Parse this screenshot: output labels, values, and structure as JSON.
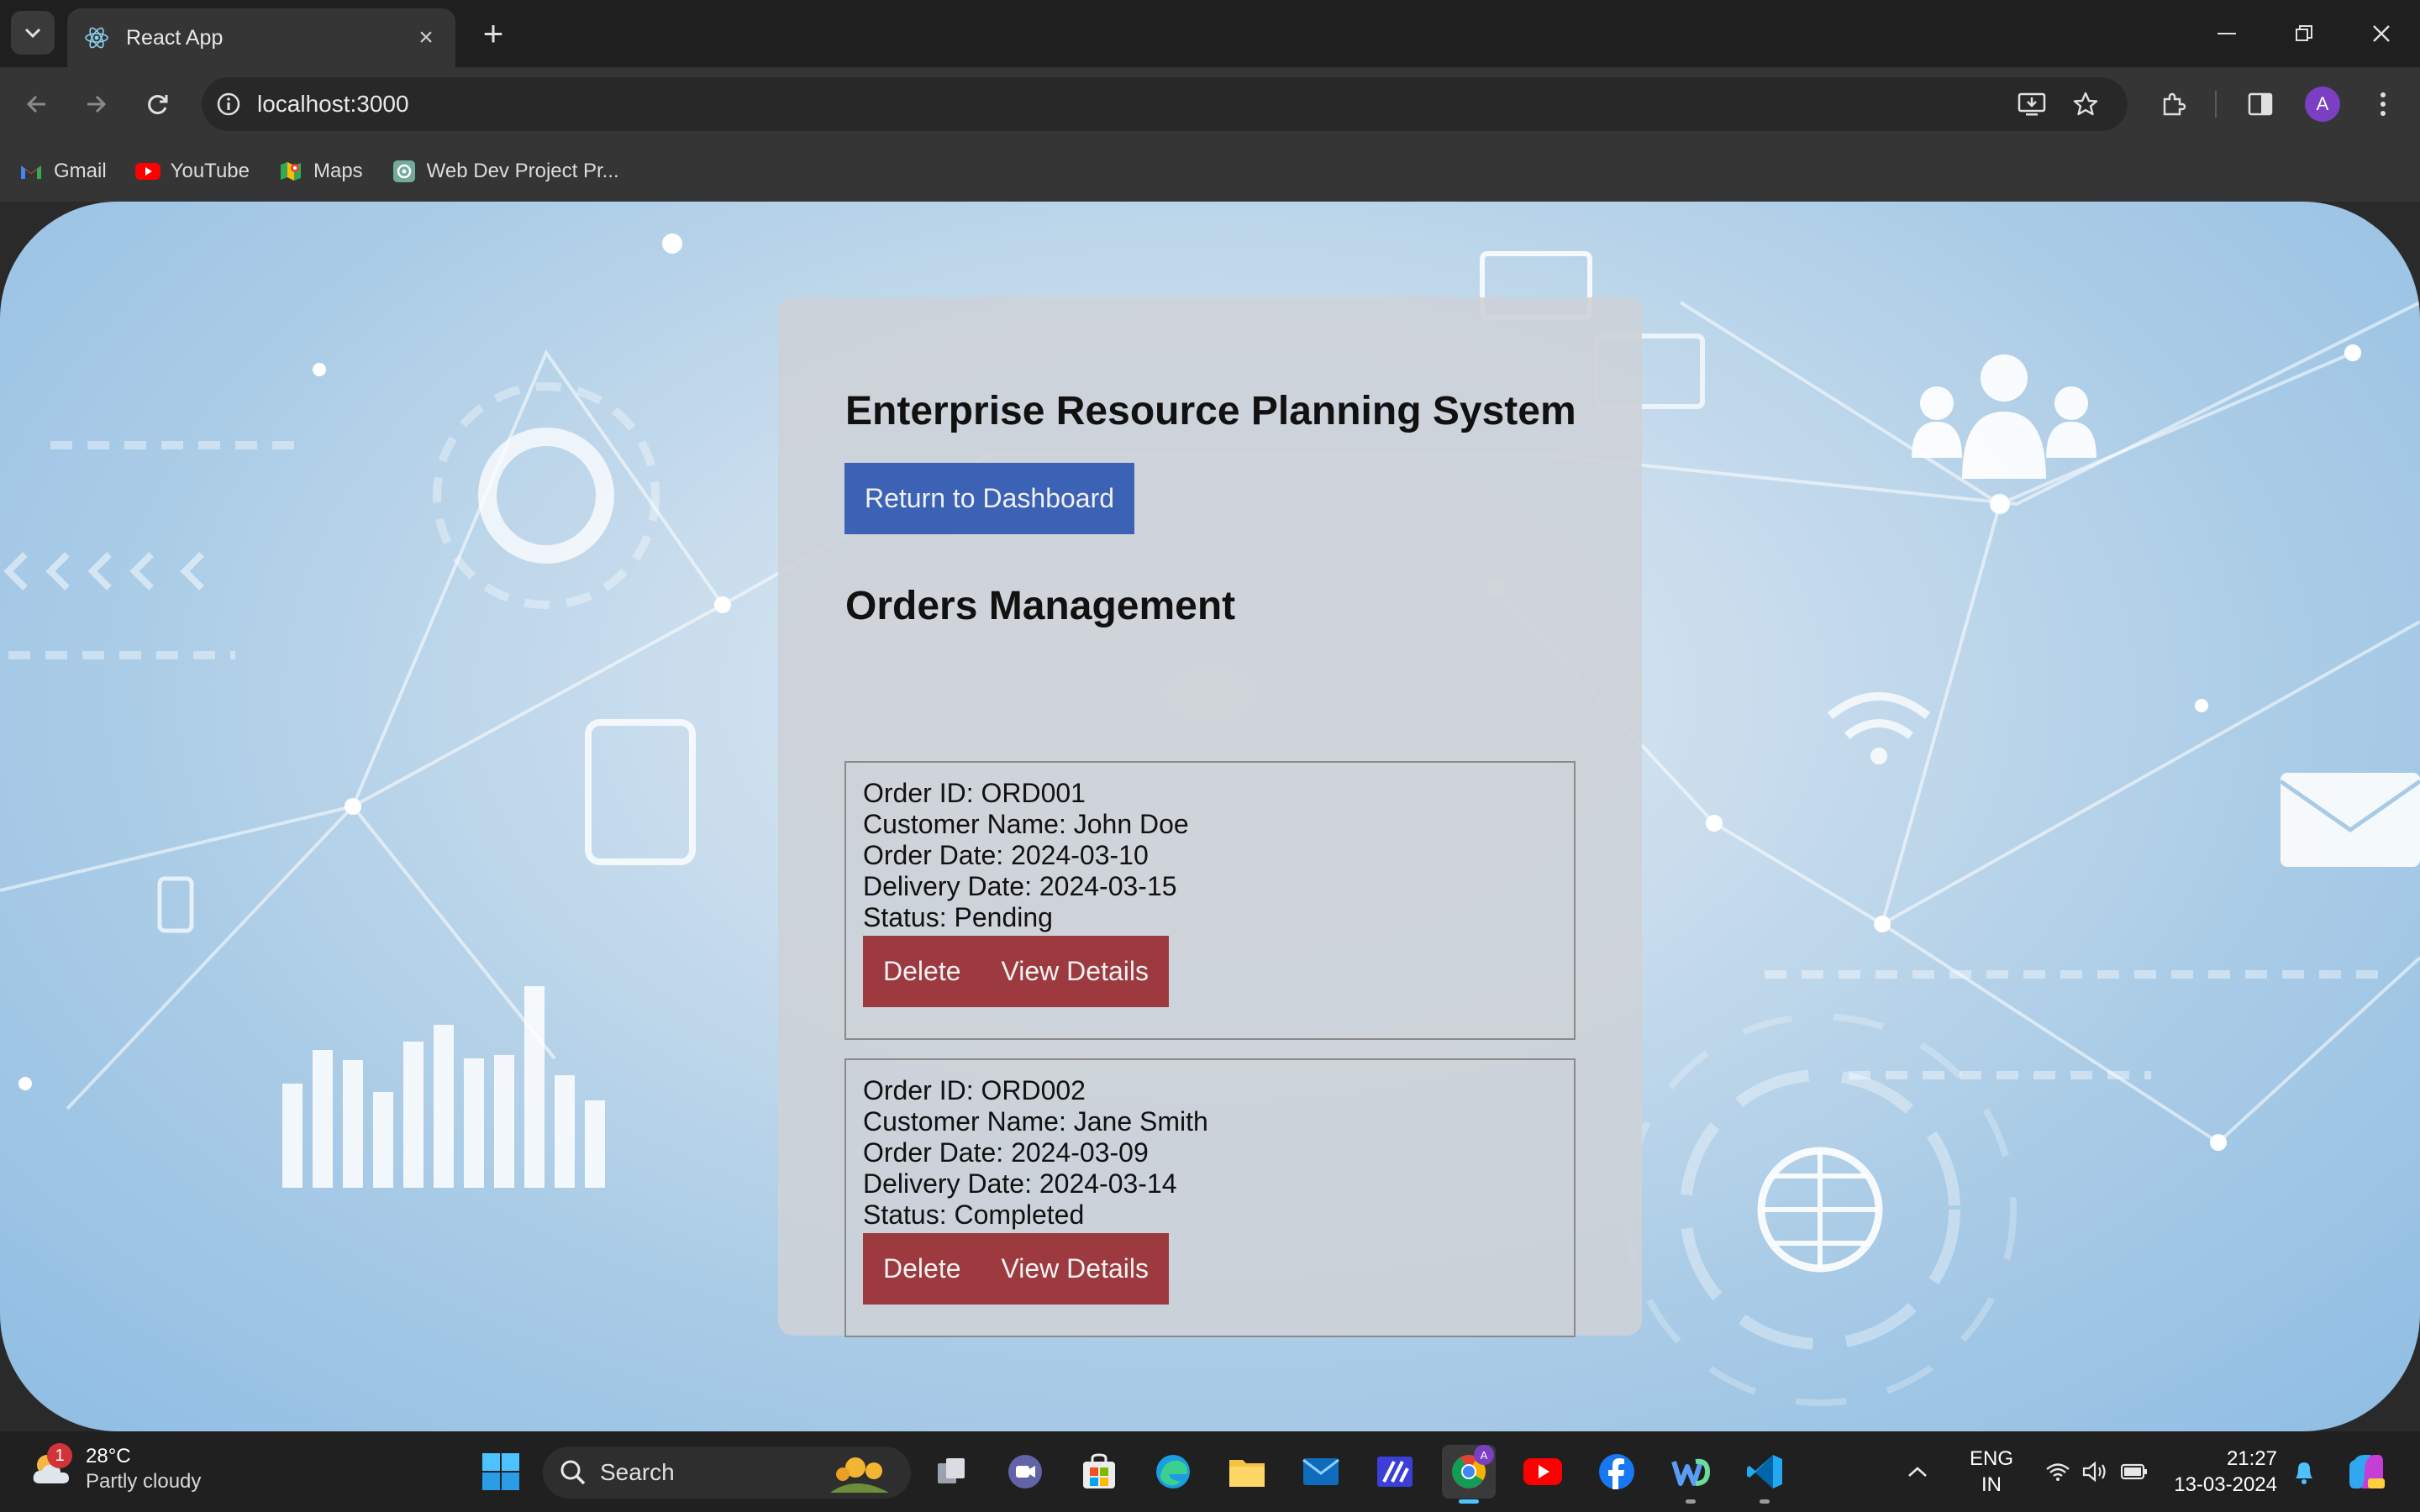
{
  "browser": {
    "tab_title": "React App",
    "url": "localhost:3000",
    "bookmarks": [
      {
        "label": "Gmail",
        "icon": "gmail-icon"
      },
      {
        "label": "YouTube",
        "icon": "youtube-icon"
      },
      {
        "label": "Maps",
        "icon": "maps-icon"
      },
      {
        "label": "Web Dev Project Pr...",
        "icon": "chatgpt-icon"
      }
    ],
    "profile_initial": "A"
  },
  "page": {
    "title": "Enterprise Resource Planning System",
    "dashboard_button": "Return to Dashboard",
    "section_title": "Orders Management",
    "orders": [
      {
        "order_id": "Order ID: ORD001",
        "customer": "Customer Name: John Doe",
        "order_date": "Order Date: 2024-03-10",
        "delivery_date": "Delivery Date: 2024-03-15",
        "status": "Status: Pending",
        "delete_label": "Delete",
        "details_label": "View Details"
      },
      {
        "order_id": "Order ID: ORD002",
        "customer": "Customer Name: Jane Smith",
        "order_date": "Order Date: 2024-03-09",
        "delivery_date": "Delivery Date: 2024-03-14",
        "status": "Status: Completed",
        "delete_label": "Delete",
        "details_label": "View Details"
      }
    ],
    "colors": {
      "primary_button": "#3c62b6",
      "danger_button": "#9c3a40"
    }
  },
  "taskbar": {
    "weather_temp": "28°C",
    "weather_desc": "Partly cloudy",
    "weather_badge": "1",
    "search_label": "Search",
    "lang_top": "ENG",
    "lang_bottom": "IN",
    "time": "21:27",
    "date": "13-03-2024",
    "profile_badge": "A"
  }
}
